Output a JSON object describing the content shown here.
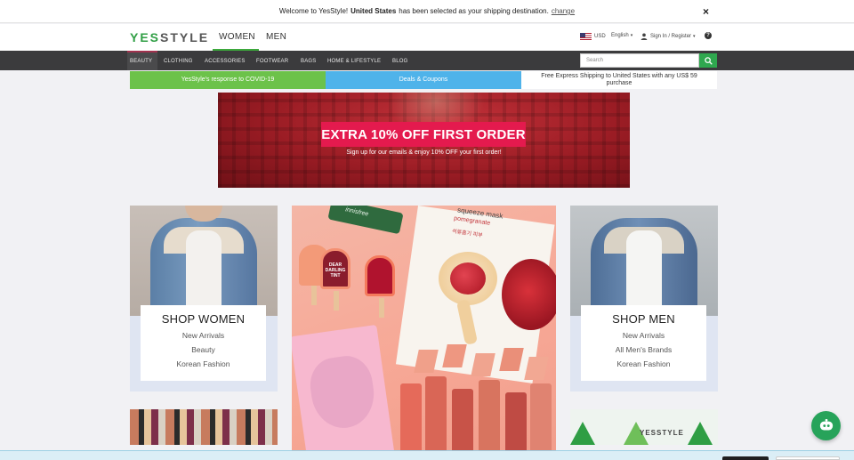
{
  "notice": {
    "prefix": "Welcome to YesStyle!",
    "country": "United States",
    "suffix": "has been selected as your shipping destination.",
    "change_link": "change",
    "close": "×"
  },
  "header": {
    "logo_yes": "YES",
    "logo_style": "STYLE",
    "tab_women": "WOMEN",
    "tab_men": "MEN",
    "currency": "USD",
    "language": "English",
    "signin": "Sign In / Register",
    "help": "?"
  },
  "catnav": {
    "items": [
      "BEAUTY",
      "CLOTHING",
      "ACCESSORIES",
      "FOOTWEAR",
      "BAGS",
      "HOME & LIFESTYLE",
      "BLOG"
    ]
  },
  "search": {
    "placeholder": "Search"
  },
  "promo": {
    "covid": "YesStyle's response to COVID-19",
    "deals": "Deals & Coupons",
    "shipping": "Free Express Shipping to United States with any US$ 59 purchase"
  },
  "hero": {
    "title": "EXTRA 10% OFF FIRST ORDER",
    "subtitle": "Sign up for our emails & enjoy 10% OFF your first order!"
  },
  "women_panel": {
    "title": "SHOP WOMEN",
    "links": [
      "New Arrivals",
      "Beauty",
      "Korean Fashion"
    ]
  },
  "men_panel": {
    "title": "SHOP MEN",
    "links": [
      "New Arrivals",
      "All Men's Brands",
      "Korean Fashion"
    ]
  },
  "beauty_image": {
    "tube_label": "innisfree",
    "mask_line1": "squeeze mask",
    "mask_line2": "pomegranate",
    "mask_line3": "석류흡기 피부",
    "pop_label": "DEAR DARLING TINT"
  },
  "right_preview_logo": "YESSTYLE",
  "colors": {
    "green": "#2fa84f",
    "covid_green": "#6cc24a",
    "deals_blue": "#4fb3ea",
    "hero_red": "#e41a4e",
    "nav_dark": "#3b3b3d"
  },
  "icons": [
    "us-flag-icon",
    "user-icon",
    "help-icon",
    "search-icon",
    "close-icon",
    "chat-icon",
    "chevron-down-icon"
  ]
}
